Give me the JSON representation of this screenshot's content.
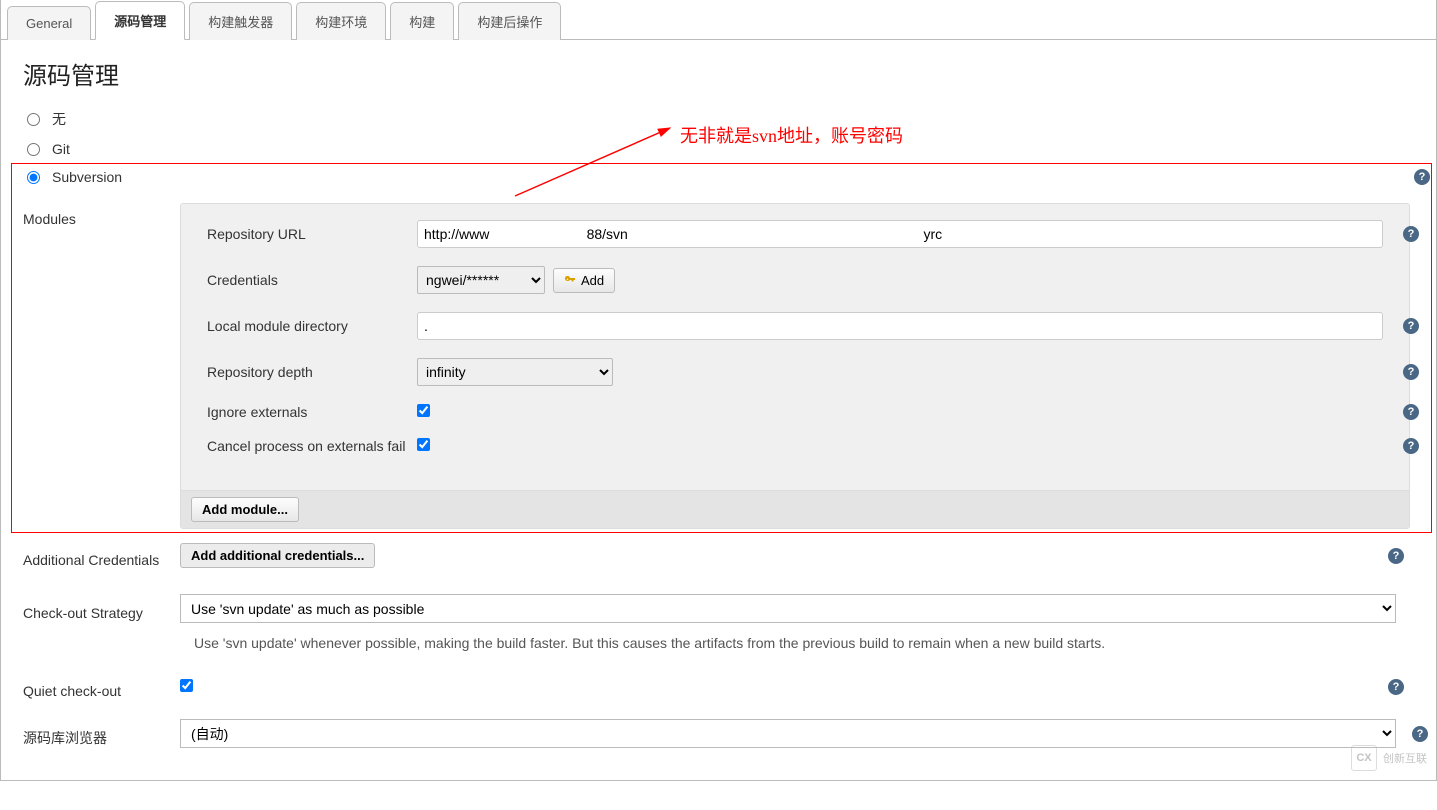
{
  "tabs": {
    "general": "General",
    "scm": "源码管理",
    "triggers": "构建触发器",
    "env": "构建环境",
    "build": "构建",
    "post": "构建后操作"
  },
  "sectionTitle": "源码管理",
  "radios": {
    "none": "无",
    "git": "Git",
    "svn": "Subversion"
  },
  "sideLabels": {
    "modules": "Modules",
    "additionalCreds": "Additional Credentials",
    "checkoutStrategy": "Check-out Strategy",
    "quietCheckout": "Quiet check-out",
    "repoBrowser": "源码库浏览器"
  },
  "moduleFields": {
    "repoUrl": {
      "label": "Repository URL",
      "value": "http://www                         88/svn                                                                            yrc"
    },
    "credentials": {
      "label": "Credentials",
      "selected": "      ngwei/******"
    },
    "localDir": {
      "label": "Local module directory",
      "value": "."
    },
    "depth": {
      "label": "Repository depth",
      "selected": "infinity"
    },
    "ignoreExternals": {
      "label": "Ignore externals",
      "checked": true
    },
    "cancelOnFail": {
      "label": "Cancel process on externals fail",
      "checked": true
    }
  },
  "buttons": {
    "addCred": "Add",
    "addModule": "Add module...",
    "addAdditionalCreds": "Add additional credentials..."
  },
  "checkoutStrategy": {
    "selected": "Use 'svn update' as much as possible",
    "hint": "Use 'svn update' whenever possible, making the build faster. But this causes the artifacts from the previous build to remain when a new build starts."
  },
  "repoBrowser": {
    "selected": "(自动)"
  },
  "quietCheckout": {
    "checked": true
  },
  "annotation": "无非就是svn地址，账号密码",
  "watermark": "创新互联"
}
